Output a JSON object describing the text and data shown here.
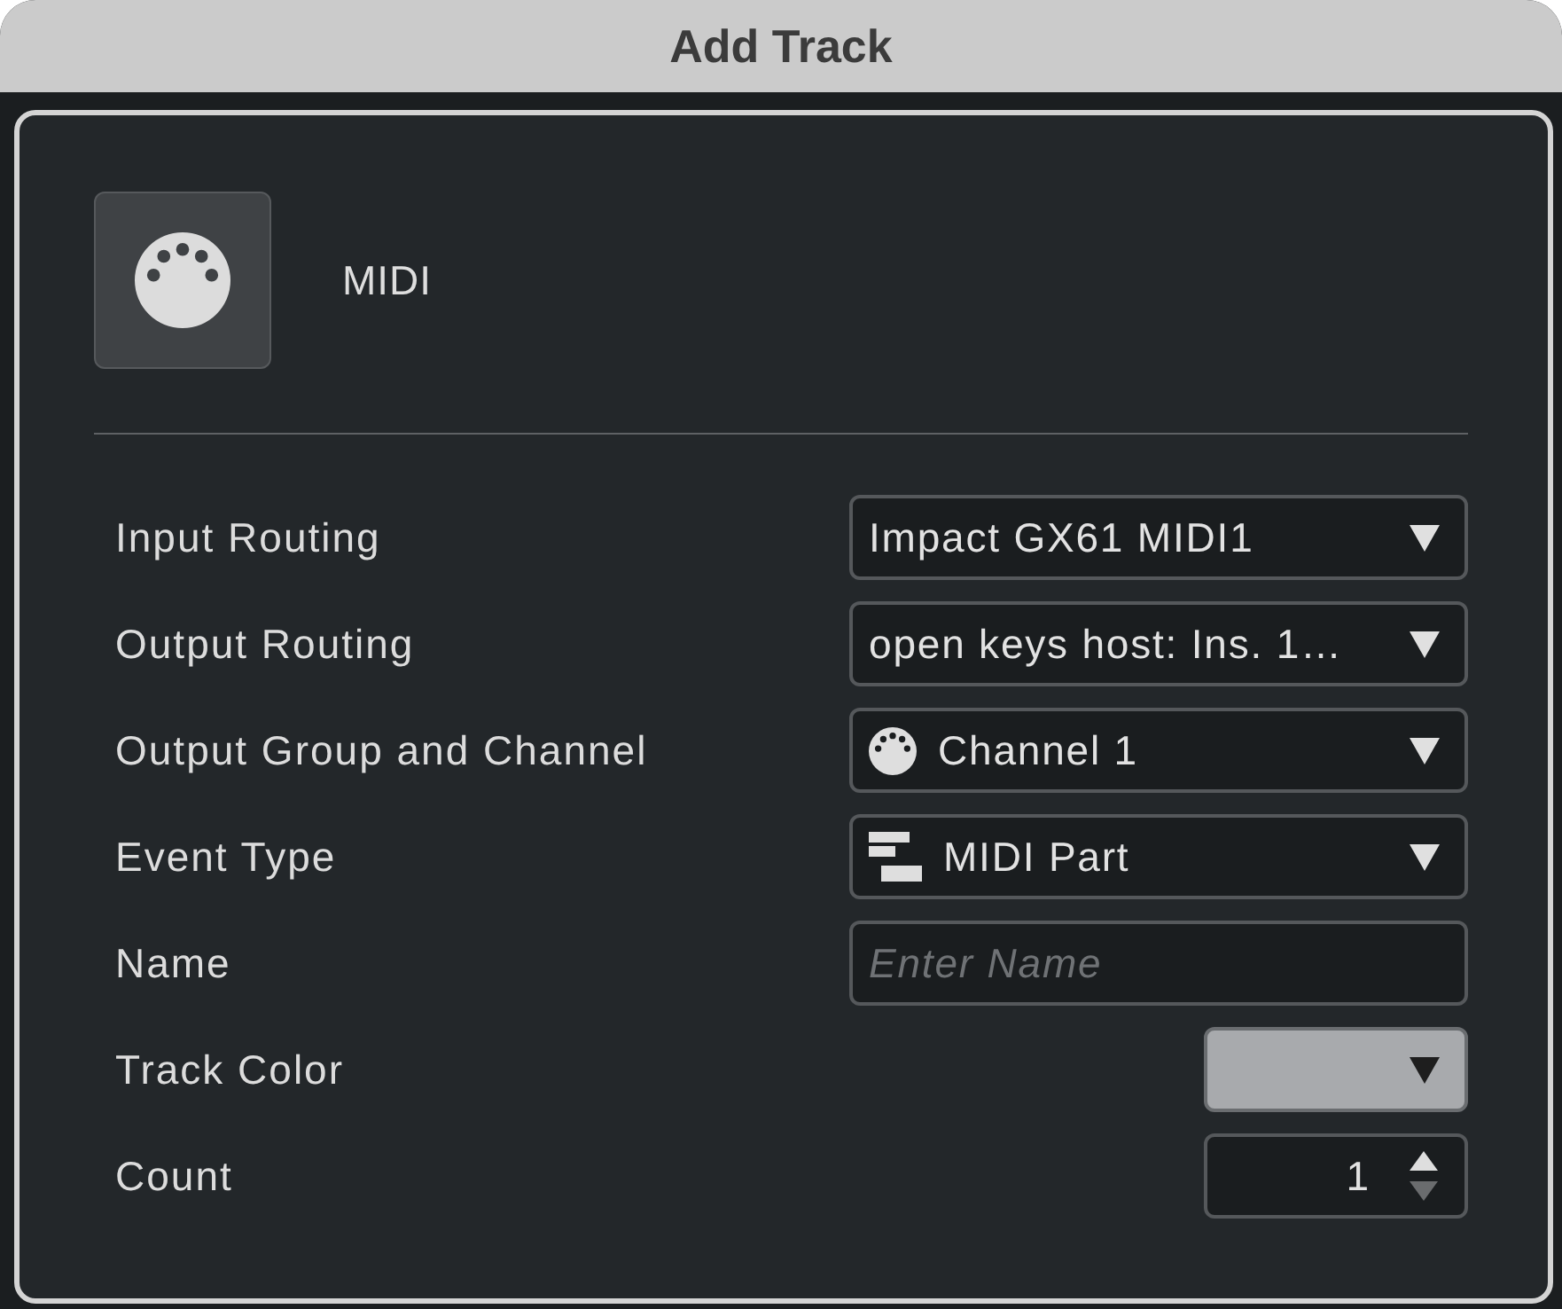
{
  "window": {
    "title": "Add Track"
  },
  "track_type": {
    "label": "MIDI"
  },
  "fields": [
    {
      "kind": "routing",
      "label": "Input Routing",
      "value": "Impact GX61 MIDI1"
    },
    {
      "kind": "routing",
      "label": "Output Routing",
      "value": "open keys host: Ins. 1…"
    },
    {
      "kind": "channel",
      "label": "Output Group and Channel",
      "value": "Channel 1"
    },
    {
      "kind": "event",
      "label": "Event Type",
      "value": "MIDI Part"
    },
    {
      "kind": "name",
      "label": "Name",
      "placeholder": "Enter Name"
    },
    {
      "kind": "color",
      "label": "Track Color",
      "color": "#a8aaad"
    },
    {
      "kind": "count",
      "label": "Count",
      "value": "1",
      "decrement_disabled": true
    }
  ]
}
